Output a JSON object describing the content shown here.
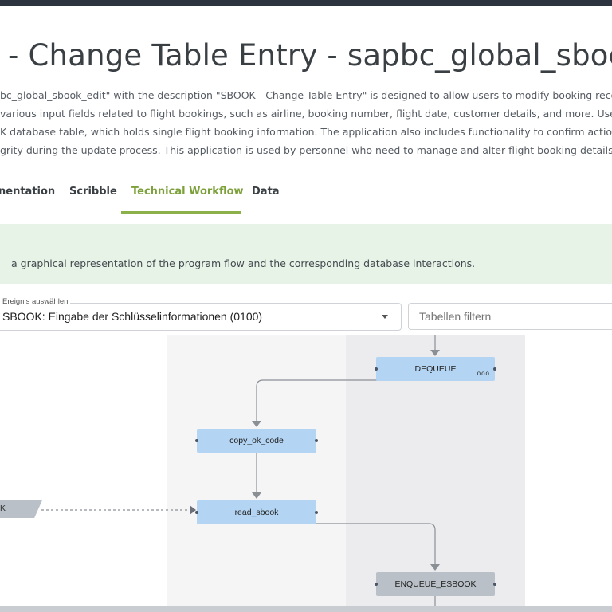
{
  "header": {
    "title": "- Change Table Entry - sapbc_global_sbook_ed"
  },
  "description": {
    "lines": [
      "bc_global_sbook_edit\" with the description \"SBOOK - Change Table Entry\" is designed to allow users to modify booking records fo",
      " various input fields related to flight bookings, such as airline, booking number, flight date, customer details, and more. Users can",
      "K database table, which holds single flight booking information. The application also includes functionality to confirm actions, han",
      "grity during the update process. This application is used by personnel who need to manage and alter flight booking details within"
    ]
  },
  "tabs": {
    "documentation": "nentation",
    "scribble": "Scribble",
    "technical_workflow": "Technical Workflow",
    "data": "Data",
    "active": "Technical Workflow"
  },
  "banner": {
    "text": "a graphical representation of the program flow and the corresponding database interactions."
  },
  "event_select": {
    "legend": "Ereignis auswählen",
    "value": "SBOOK: Eingabe der Schlüsselinformationen (0100)"
  },
  "table_filter": {
    "placeholder": "Tabellen filtern"
  },
  "workflow": {
    "nodes": {
      "dequeue": "DEQUEUE",
      "copy_ok_code": "copy_ok_code",
      "read_sbook": "read_sbook",
      "enqueue_esbook": "ENQUEUE_ESBOOK",
      "db_table_partial": "K"
    },
    "more_menu": "ooo"
  },
  "colors": {
    "accent_green": "#8db14a",
    "node_blue": "#b3d4f2",
    "node_gray": "#b9c0c8",
    "banner_bg": "#e7f3e7"
  }
}
